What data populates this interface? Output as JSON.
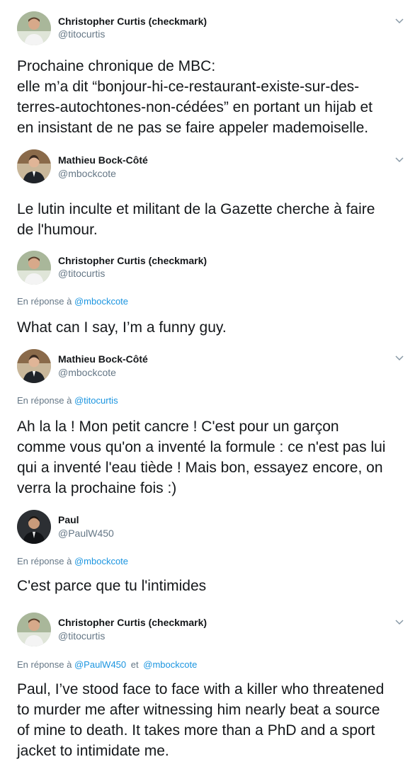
{
  "tweets": [
    {
      "name": "Christopher Curtis (checkmark)",
      "handle": "@titocurtis",
      "lines": [
        "Prochaine chronique de MBC:",
        "elle m’a dit “bonjour-hi-ce-restaurant-existe-sur-des-",
        "terres-autochtones-non-cédées” en portant un hijab et",
        "en insistant de ne pas se faire appeler mademoiselle."
      ]
    },
    {
      "name": "Mathieu Bock-Côté",
      "handle": "@mbockcote",
      "lines": [
        "Le lutin inculte et militant de la Gazette cherche à faire",
        "de l'humour."
      ]
    },
    {
      "name": "Christopher Curtis (checkmark)",
      "handle": "@titocurtis",
      "reply_prefix": "En réponse à",
      "reply_to": "@mbockcote",
      "lines": [
        "What can I say, I’m a funny guy."
      ]
    },
    {
      "name": "Mathieu Bock-Côté",
      "handle": "@mbockcote",
      "reply_prefix": "En réponse à",
      "reply_to": "@titocurtis",
      "lines": [
        "Ah la la ! Mon petit cancre ! C'est pour un garçon",
        "comme vous qu'on a inventé la formule : ce n'est pas lui",
        "qui a inventé l'eau tiède ! Mais bon, essayez encore, on",
        "verra la prochaine fois :)"
      ]
    },
    {
      "name": "Paul",
      "handle": "@PaulW450",
      "reply_prefix": "En réponse à",
      "reply_to": "@mbockcote",
      "lines": [
        "C'est parce que tu l'intimides"
      ]
    },
    {
      "name": "Christopher Curtis (checkmark)",
      "handle": "@titocurtis",
      "reply_prefix": "En réponse à",
      "reply_to": "@PaulW450",
      "reply_joiner": "et",
      "reply_to_2": "@mbockcote",
      "lines": [
        "Paul, I’ve stood face to face with a killer who threatened",
        "to murder me after witnessing him nearly beat a source",
        "of mine to death. It takes more than a PhD and a sport",
        "jacket to intimidate me."
      ]
    }
  ]
}
